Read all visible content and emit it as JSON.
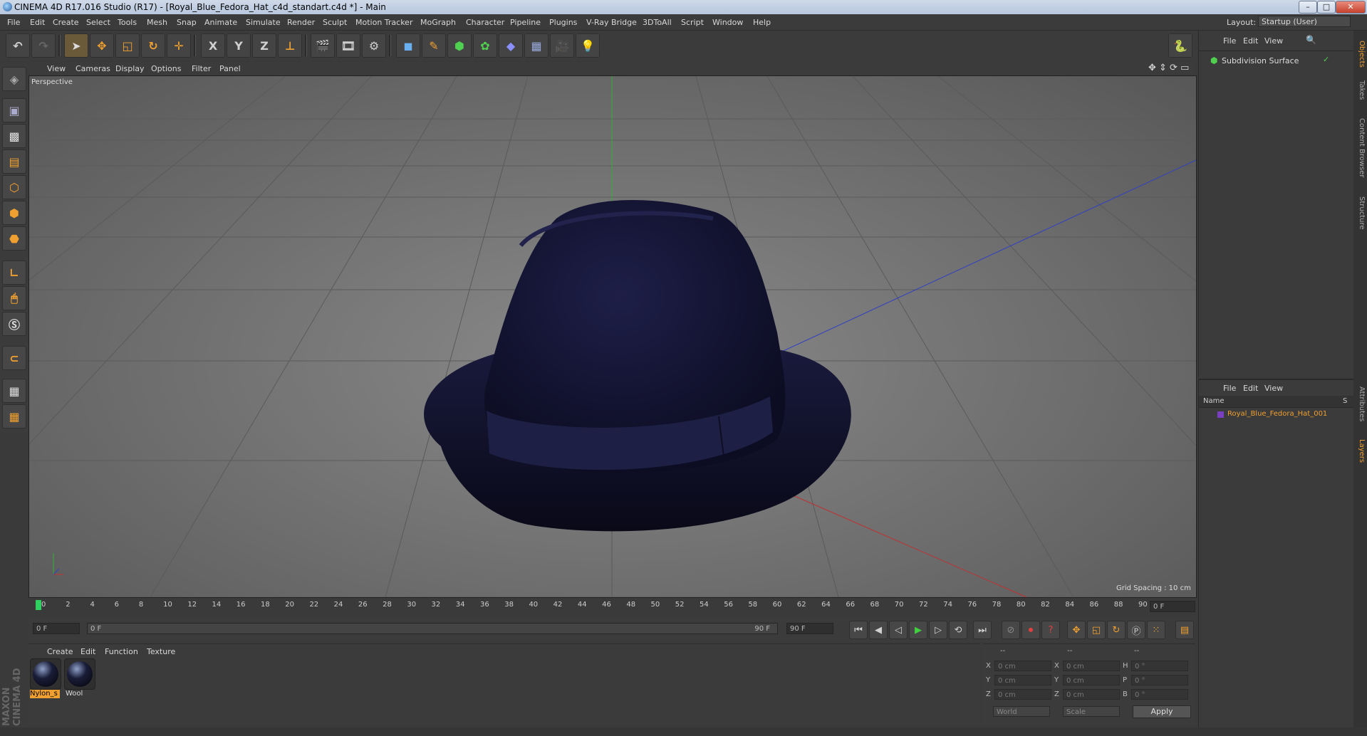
{
  "window": {
    "title": "CINEMA 4D R17.016 Studio (R17) - [Royal_Blue_Fedora_Hat_c4d_standart.c4d *] - Main",
    "controls": [
      "–",
      "□",
      "✕"
    ]
  },
  "menubar": {
    "items": [
      "File",
      "Edit",
      "Create",
      "Select",
      "Tools",
      "Mesh",
      "Snap",
      "Animate",
      "Simulate",
      "Render",
      "Sculpt",
      "Motion Tracker",
      "MoGraph",
      "Character",
      "Pipeline",
      "Plugins",
      "V-Ray Bridge",
      "3DToAll",
      "Script",
      "Window",
      "Help"
    ],
    "layout_label": "Layout:",
    "layout_value": "Startup (User)"
  },
  "toolbar": {
    "axis_x": "X",
    "axis_y": "Y",
    "axis_z": "Z"
  },
  "viewport": {
    "menu": [
      "View",
      "Cameras",
      "Display",
      "Options",
      "Filter",
      "Panel"
    ],
    "label": "Perspective",
    "grid_spacing": "Grid Spacing : 10 cm"
  },
  "timeline": {
    "ticks": [
      "0",
      "2",
      "4",
      "6",
      "8",
      "10",
      "12",
      "14",
      "16",
      "18",
      "20",
      "22",
      "24",
      "26",
      "28",
      "30",
      "32",
      "34",
      "36",
      "38",
      "40",
      "42",
      "44",
      "46",
      "48",
      "50",
      "52",
      "54",
      "56",
      "58",
      "60",
      "62",
      "64",
      "66",
      "68",
      "70",
      "72",
      "74",
      "76",
      "78",
      "80",
      "82",
      "84",
      "86",
      "88",
      "90"
    ],
    "current_frame": "0 F",
    "start_frame": "0 F",
    "range_start": "0 F",
    "range_end": "90 F",
    "end_frame": "90 F"
  },
  "materials": {
    "menu": [
      "Create",
      "Edit",
      "Function",
      "Texture"
    ],
    "items": [
      {
        "name": "Nylon_s",
        "selected": true
      },
      {
        "name": "Wool",
        "selected": false
      }
    ]
  },
  "coordinates": {
    "header": [
      "--",
      "--",
      "--"
    ],
    "rows": [
      {
        "a": "X",
        "av": "0 cm",
        "b": "X",
        "bv": "0 cm",
        "c": "H",
        "cv": "0 °"
      },
      {
        "a": "Y",
        "av": "0 cm",
        "b": "Y",
        "bv": "0 cm",
        "c": "P",
        "cv": "0 °"
      },
      {
        "a": "Z",
        "av": "0 cm",
        "b": "Z",
        "bv": "0 cm",
        "c": "B",
        "cv": "0 °"
      }
    ],
    "world": "World",
    "scale": "Scale",
    "apply": "Apply"
  },
  "object_manager": {
    "menu": [
      "File",
      "Edit",
      "View"
    ],
    "objects": [
      {
        "name": "Subdivision Surface"
      }
    ]
  },
  "layer_manager": {
    "menu": [
      "File",
      "Edit",
      "View"
    ],
    "col_name": "Name",
    "col_s": "S",
    "layers": [
      {
        "name": "Royal_Blue_Fedora_Hat_001",
        "color": "#7a3fc0"
      }
    ]
  },
  "side_tabs": [
    "Objects",
    "Takes",
    "Content Browser",
    "Structure",
    "Attributes",
    "Layers"
  ],
  "brand": "MAXON CINEMA 4D",
  "colors": {
    "accent": "#f0a030",
    "hat": "#15163a",
    "x_axis": "#c03030",
    "y_axis": "#30b030",
    "z_axis": "#3040c0"
  }
}
